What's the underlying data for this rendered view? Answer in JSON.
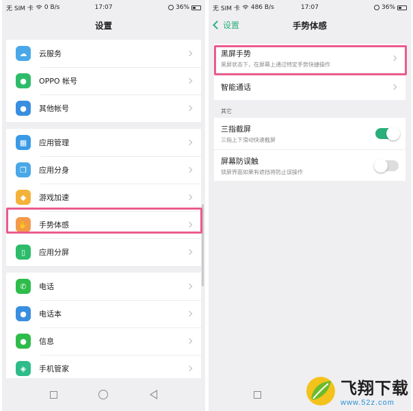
{
  "left": {
    "status": {
      "carrier": "无 SIM 卡",
      "speed": "0 B/s",
      "time": "17:07",
      "battery": "36%"
    },
    "title": "设置",
    "groups": [
      [
        {
          "label": "云服务",
          "icon": "cloud-icon",
          "color": "#4aa8e8"
        },
        {
          "label": "OPPO 帐号",
          "icon": "person-icon",
          "color": "#2ebc6a"
        },
        {
          "label": "其他帐号",
          "icon": "person-icon",
          "color": "#3a8ee0"
        }
      ],
      [
        {
          "label": "应用管理",
          "icon": "grid-icon",
          "color": "#3a9ae6"
        },
        {
          "label": "应用分身",
          "icon": "clone-icon",
          "color": "#4aa8e8"
        },
        {
          "label": "游戏加速",
          "icon": "gamepad-icon",
          "color": "#f3b23a"
        },
        {
          "label": "手势体感",
          "icon": "hand-icon",
          "color": "#f39a4a"
        },
        {
          "label": "应用分屏",
          "icon": "split-screen-icon",
          "color": "#2ebc6a"
        }
      ],
      [
        {
          "label": "电话",
          "icon": "phone-icon",
          "color": "#2ebc4a"
        },
        {
          "label": "电话本",
          "icon": "contacts-icon",
          "color": "#3a8ee0"
        },
        {
          "label": "信息",
          "icon": "message-icon",
          "color": "#2ebc4a"
        },
        {
          "label": "手机管家",
          "icon": "shield-icon",
          "color": "#2ebc8a"
        }
      ]
    ]
  },
  "right": {
    "status": {
      "carrier": "无 SIM 卡",
      "speed": "486 B/s",
      "time": "17:07",
      "battery": "36%"
    },
    "back_label": "设置",
    "title": "手势体感",
    "items": [
      {
        "title": "黑屏手势",
        "subtitle": "黑屏状态下，在屏幕上通过特定手势快捷操作"
      },
      {
        "title": "智能通话",
        "subtitle": ""
      }
    ],
    "section": "其它",
    "toggles": [
      {
        "title": "三指截屏",
        "subtitle": "三指上下滑动快速截屏",
        "on": true
      },
      {
        "title": "屏幕防误触",
        "subtitle": "锁屏界面如果有遮挡将防止误操作",
        "on": false
      }
    ]
  },
  "watermark": {
    "title": "飞翔下载",
    "url": "www.52z.com"
  }
}
